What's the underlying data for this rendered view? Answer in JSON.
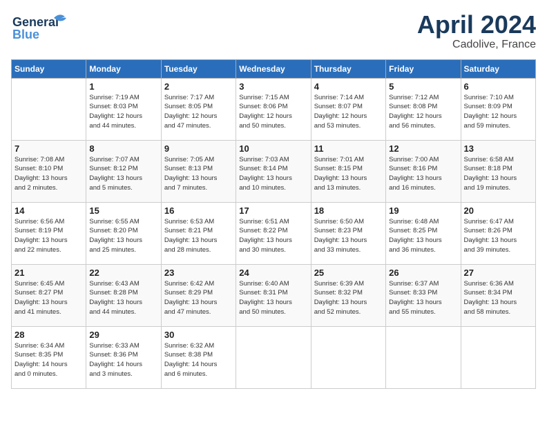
{
  "header": {
    "logo_line1": "General",
    "logo_line2": "Blue",
    "month": "April 2024",
    "location": "Cadolive, France"
  },
  "days_of_week": [
    "Sunday",
    "Monday",
    "Tuesday",
    "Wednesday",
    "Thursday",
    "Friday",
    "Saturday"
  ],
  "weeks": [
    [
      {
        "num": "",
        "info": ""
      },
      {
        "num": "1",
        "info": "Sunrise: 7:19 AM\nSunset: 8:03 PM\nDaylight: 12 hours\nand 44 minutes."
      },
      {
        "num": "2",
        "info": "Sunrise: 7:17 AM\nSunset: 8:05 PM\nDaylight: 12 hours\nand 47 minutes."
      },
      {
        "num": "3",
        "info": "Sunrise: 7:15 AM\nSunset: 8:06 PM\nDaylight: 12 hours\nand 50 minutes."
      },
      {
        "num": "4",
        "info": "Sunrise: 7:14 AM\nSunset: 8:07 PM\nDaylight: 12 hours\nand 53 minutes."
      },
      {
        "num": "5",
        "info": "Sunrise: 7:12 AM\nSunset: 8:08 PM\nDaylight: 12 hours\nand 56 minutes."
      },
      {
        "num": "6",
        "info": "Sunrise: 7:10 AM\nSunset: 8:09 PM\nDaylight: 12 hours\nand 59 minutes."
      }
    ],
    [
      {
        "num": "7",
        "info": "Sunrise: 7:08 AM\nSunset: 8:10 PM\nDaylight: 13 hours\nand 2 minutes."
      },
      {
        "num": "8",
        "info": "Sunrise: 7:07 AM\nSunset: 8:12 PM\nDaylight: 13 hours\nand 5 minutes."
      },
      {
        "num": "9",
        "info": "Sunrise: 7:05 AM\nSunset: 8:13 PM\nDaylight: 13 hours\nand 7 minutes."
      },
      {
        "num": "10",
        "info": "Sunrise: 7:03 AM\nSunset: 8:14 PM\nDaylight: 13 hours\nand 10 minutes."
      },
      {
        "num": "11",
        "info": "Sunrise: 7:01 AM\nSunset: 8:15 PM\nDaylight: 13 hours\nand 13 minutes."
      },
      {
        "num": "12",
        "info": "Sunrise: 7:00 AM\nSunset: 8:16 PM\nDaylight: 13 hours\nand 16 minutes."
      },
      {
        "num": "13",
        "info": "Sunrise: 6:58 AM\nSunset: 8:18 PM\nDaylight: 13 hours\nand 19 minutes."
      }
    ],
    [
      {
        "num": "14",
        "info": "Sunrise: 6:56 AM\nSunset: 8:19 PM\nDaylight: 13 hours\nand 22 minutes."
      },
      {
        "num": "15",
        "info": "Sunrise: 6:55 AM\nSunset: 8:20 PM\nDaylight: 13 hours\nand 25 minutes."
      },
      {
        "num": "16",
        "info": "Sunrise: 6:53 AM\nSunset: 8:21 PM\nDaylight: 13 hours\nand 28 minutes."
      },
      {
        "num": "17",
        "info": "Sunrise: 6:51 AM\nSunset: 8:22 PM\nDaylight: 13 hours\nand 30 minutes."
      },
      {
        "num": "18",
        "info": "Sunrise: 6:50 AM\nSunset: 8:23 PM\nDaylight: 13 hours\nand 33 minutes."
      },
      {
        "num": "19",
        "info": "Sunrise: 6:48 AM\nSunset: 8:25 PM\nDaylight: 13 hours\nand 36 minutes."
      },
      {
        "num": "20",
        "info": "Sunrise: 6:47 AM\nSunset: 8:26 PM\nDaylight: 13 hours\nand 39 minutes."
      }
    ],
    [
      {
        "num": "21",
        "info": "Sunrise: 6:45 AM\nSunset: 8:27 PM\nDaylight: 13 hours\nand 41 minutes."
      },
      {
        "num": "22",
        "info": "Sunrise: 6:43 AM\nSunset: 8:28 PM\nDaylight: 13 hours\nand 44 minutes."
      },
      {
        "num": "23",
        "info": "Sunrise: 6:42 AM\nSunset: 8:29 PM\nDaylight: 13 hours\nand 47 minutes."
      },
      {
        "num": "24",
        "info": "Sunrise: 6:40 AM\nSunset: 8:31 PM\nDaylight: 13 hours\nand 50 minutes."
      },
      {
        "num": "25",
        "info": "Sunrise: 6:39 AM\nSunset: 8:32 PM\nDaylight: 13 hours\nand 52 minutes."
      },
      {
        "num": "26",
        "info": "Sunrise: 6:37 AM\nSunset: 8:33 PM\nDaylight: 13 hours\nand 55 minutes."
      },
      {
        "num": "27",
        "info": "Sunrise: 6:36 AM\nSunset: 8:34 PM\nDaylight: 13 hours\nand 58 minutes."
      }
    ],
    [
      {
        "num": "28",
        "info": "Sunrise: 6:34 AM\nSunset: 8:35 PM\nDaylight: 14 hours\nand 0 minutes."
      },
      {
        "num": "29",
        "info": "Sunrise: 6:33 AM\nSunset: 8:36 PM\nDaylight: 14 hours\nand 3 minutes."
      },
      {
        "num": "30",
        "info": "Sunrise: 6:32 AM\nSunset: 8:38 PM\nDaylight: 14 hours\nand 6 minutes."
      },
      {
        "num": "",
        "info": ""
      },
      {
        "num": "",
        "info": ""
      },
      {
        "num": "",
        "info": ""
      },
      {
        "num": "",
        "info": ""
      }
    ]
  ]
}
